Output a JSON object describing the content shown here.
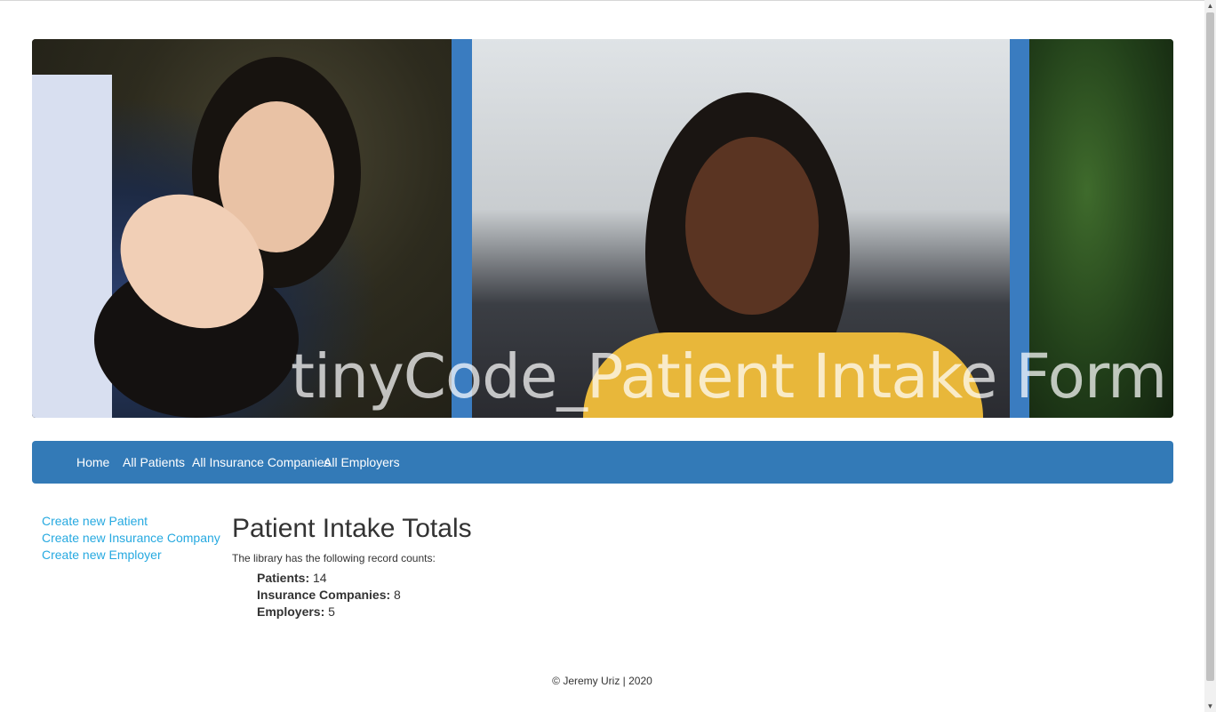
{
  "banner": {
    "title": "tinyCode_Patient Intake Form"
  },
  "nav": {
    "items": [
      {
        "label": "Home"
      },
      {
        "label": "All Patients"
      },
      {
        "label": "All Insurance Companies"
      },
      {
        "label": "All Employers"
      }
    ]
  },
  "sidebar": {
    "links": [
      {
        "label": "Create new Patient"
      },
      {
        "label": "Create new Insurance Company"
      },
      {
        "label": "Create new Employer"
      }
    ]
  },
  "main": {
    "title": "Patient Intake Totals",
    "intro": "The library has the following record counts:",
    "stats": [
      {
        "label": "Patients:",
        "value": "14"
      },
      {
        "label": "Insurance Companies:",
        "value": "8"
      },
      {
        "label": "Employers:",
        "value": "5"
      }
    ]
  },
  "footer": {
    "text": "© Jeremy Uriz | 2020"
  },
  "colors": {
    "nav_bg": "#337ab7",
    "link": "#26a9e0",
    "banner_accent": "#3a7cc0"
  },
  "icons": {
    "scroll_up": "chevron-up-icon",
    "scroll_down": "chevron-down-icon"
  }
}
